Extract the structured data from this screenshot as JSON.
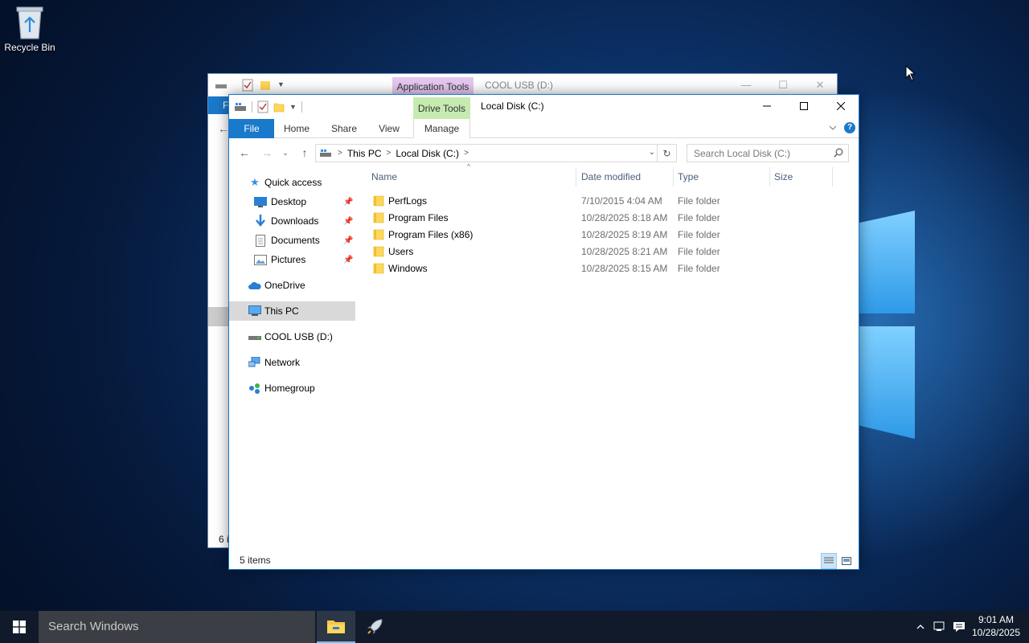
{
  "desktop": {
    "recycle_bin_label": "Recycle Bin"
  },
  "back_window": {
    "context_tab": "Application Tools",
    "title": "COOL USB (D:)",
    "file_tab_initial": "F",
    "status_partial": "6 i"
  },
  "window": {
    "context_tab": "Drive Tools",
    "title": "Local Disk (C:)",
    "ribbon_tabs": {
      "file": "File",
      "home": "Home",
      "share": "Share",
      "view": "View",
      "manage": "Manage"
    },
    "address": {
      "crumbs": [
        "This PC",
        "Local Disk (C:)"
      ]
    },
    "search_placeholder": "Search Local Disk (C:)",
    "nav": {
      "quick_access": "Quick access",
      "desktop": "Desktop",
      "downloads": "Downloads",
      "documents": "Documents",
      "pictures": "Pictures",
      "onedrive": "OneDrive",
      "this_pc": "This PC",
      "cool_usb": "COOL USB (D:)",
      "network": "Network",
      "homegroup": "Homegroup"
    },
    "columns": {
      "name": "Name",
      "date": "Date modified",
      "type": "Type",
      "size": "Size"
    },
    "files": [
      {
        "name": "PerfLogs",
        "date": "7/10/2015 4:04 AM",
        "type": "File folder"
      },
      {
        "name": "Program Files",
        "date": "10/28/2025 8:18 AM",
        "type": "File folder"
      },
      {
        "name": "Program Files (x86)",
        "date": "10/28/2025 8:19 AM",
        "type": "File folder"
      },
      {
        "name": "Users",
        "date": "10/28/2025 8:21 AM",
        "type": "File folder"
      },
      {
        "name": "Windows",
        "date": "10/28/2025 8:15 AM",
        "type": "File folder"
      }
    ],
    "status_count": "5 items"
  },
  "taskbar": {
    "search_placeholder": "Search Windows",
    "time": "9:01 AM",
    "date": "10/28/2025"
  },
  "colors": {
    "accent": "#1979ca",
    "drive_tools_tab": "#c6ebb0",
    "application_tools_tab": "#e5c8f0",
    "taskbar": "#101a2a"
  }
}
